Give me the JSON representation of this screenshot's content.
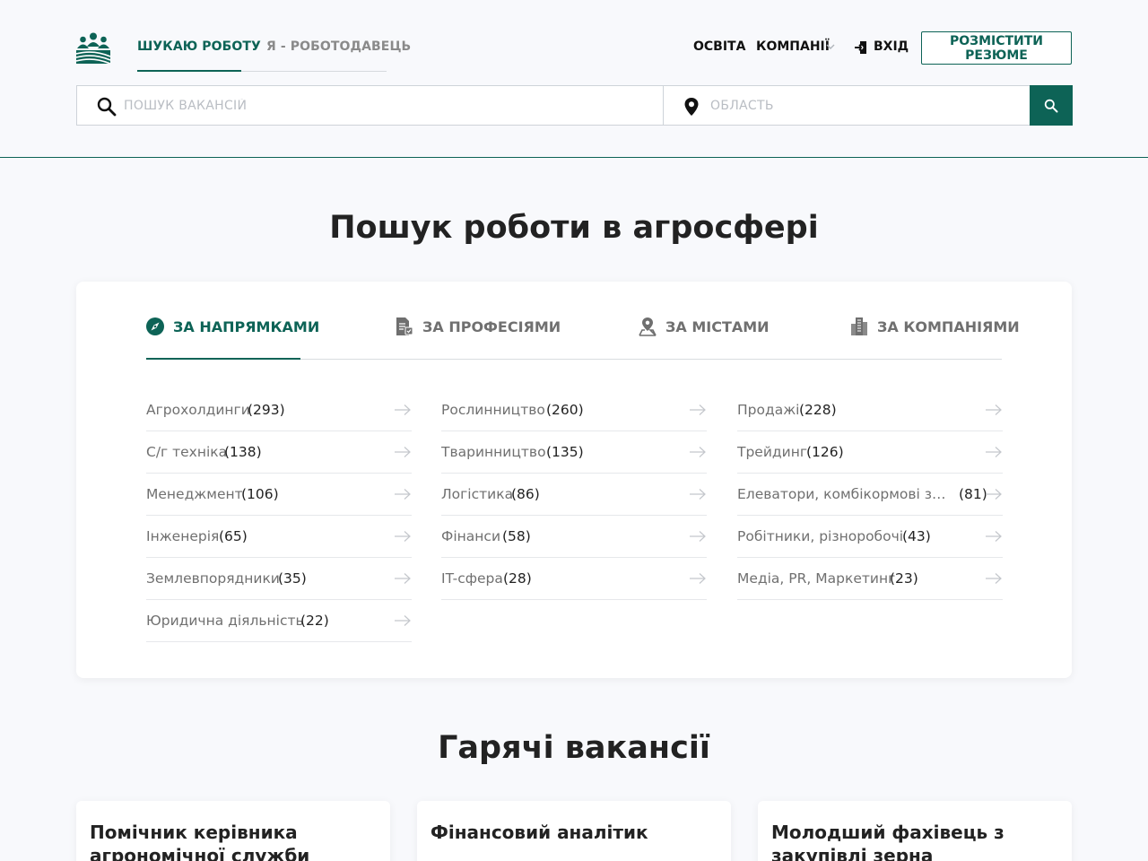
{
  "nav": {
    "tab_jobseeker": "ШУКАЮ РОБОТУ",
    "tab_employer": "Я - РОБОТОДАВЕЦЬ",
    "education": "ОСВІТА",
    "companies": "КОМПАНІЇ",
    "login": "ВХІД",
    "post_resume": "РОЗМІСТИТИ РЕЗЮМЕ"
  },
  "search": {
    "vacancy_placeholder": "ПОШУК ВАКАНСІЙ",
    "region_placeholder": "ОБЛАСТЬ"
  },
  "main": {
    "title": "Пошук роботи в агросфері",
    "tabs": [
      {
        "label": "ЗА НАПРЯМКАМИ",
        "icon": "compass-icon",
        "active": true
      },
      {
        "label": "ЗА ПРОФЕСІЯМИ",
        "icon": "document-icon",
        "active": false
      },
      {
        "label": "ЗА МІСТАМИ",
        "icon": "location-person-icon",
        "active": false
      },
      {
        "label": "ЗА КОМПАНІЯМИ",
        "icon": "buildings-icon",
        "active": false
      }
    ],
    "columns": [
      [
        {
          "name": "Агрохолдинги",
          "count": "(293)"
        },
        {
          "name": "С/г техніка",
          "count": "(138)"
        },
        {
          "name": "Менеджмент",
          "count": "(106)"
        },
        {
          "name": "Інженерія",
          "count": "(65)"
        },
        {
          "name": "Землевпорядники",
          "count": "(35)"
        },
        {
          "name": "Юридична діяльність",
          "count": "(22)"
        }
      ],
      [
        {
          "name": "Рослинництво",
          "count": "(260)"
        },
        {
          "name": "Тваринництво",
          "count": "(135)"
        },
        {
          "name": "Логістика",
          "count": "(86)"
        },
        {
          "name": "Фінанси",
          "count": "(58)"
        },
        {
          "name": "IT-сфера",
          "count": "(28)"
        }
      ],
      [
        {
          "name": "Продажі",
          "count": "(228)"
        },
        {
          "name": "Трейдинг",
          "count": "(126)"
        },
        {
          "name": "Елеватори, комбікормові зав...",
          "count": "(81)"
        },
        {
          "name": "Робітники, різноробочі",
          "count": "(43)"
        },
        {
          "name": "Медіа, PR, Маркетинг",
          "count": "(23)"
        }
      ]
    ]
  },
  "hot": {
    "title": "Гарячі вакансії",
    "jobs": [
      {
        "title": "Помічник керівника агрономічної служби"
      },
      {
        "title": "Фінансовий аналітик"
      },
      {
        "title": "Молодший фахівець з закупівлі зерна"
      }
    ]
  },
  "colors": {
    "accent": "#0d6356",
    "muted": "#707070"
  }
}
